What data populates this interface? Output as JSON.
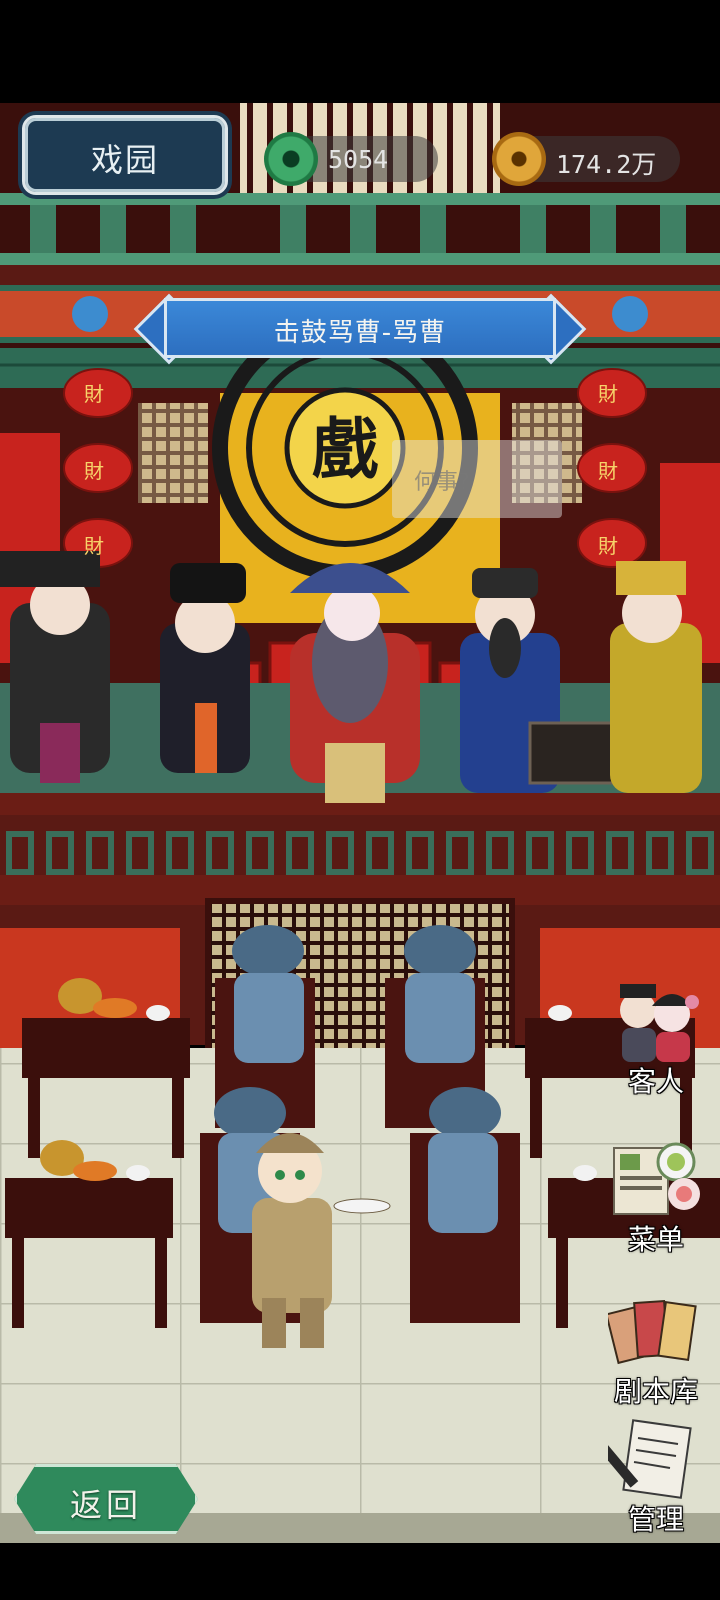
{
  "header": {
    "venue_title": "戏园",
    "jade_currency": "5054",
    "gold_currency": "174.2万"
  },
  "stage": {
    "play_title": "击鼓骂曹-骂曹",
    "emblem_char": "戲",
    "lantern_char": "財",
    "ghost_tip": "何事?"
  },
  "side_menu": [
    {
      "label": "客人",
      "icon": "guests-icon"
    },
    {
      "label": "菜单",
      "icon": "menu-icon"
    },
    {
      "label": "剧本库",
      "icon": "script-library-icon"
    },
    {
      "label": "管理",
      "icon": "manage-icon"
    }
  ],
  "footer": {
    "back_label": "返回"
  },
  "colors": {
    "wood": "#5a1a14",
    "jade": "#2f8a5c",
    "stage_gold": "#e8b21e",
    "banner_blue": "#3b88d8",
    "lantern_red": "#c8231e"
  }
}
